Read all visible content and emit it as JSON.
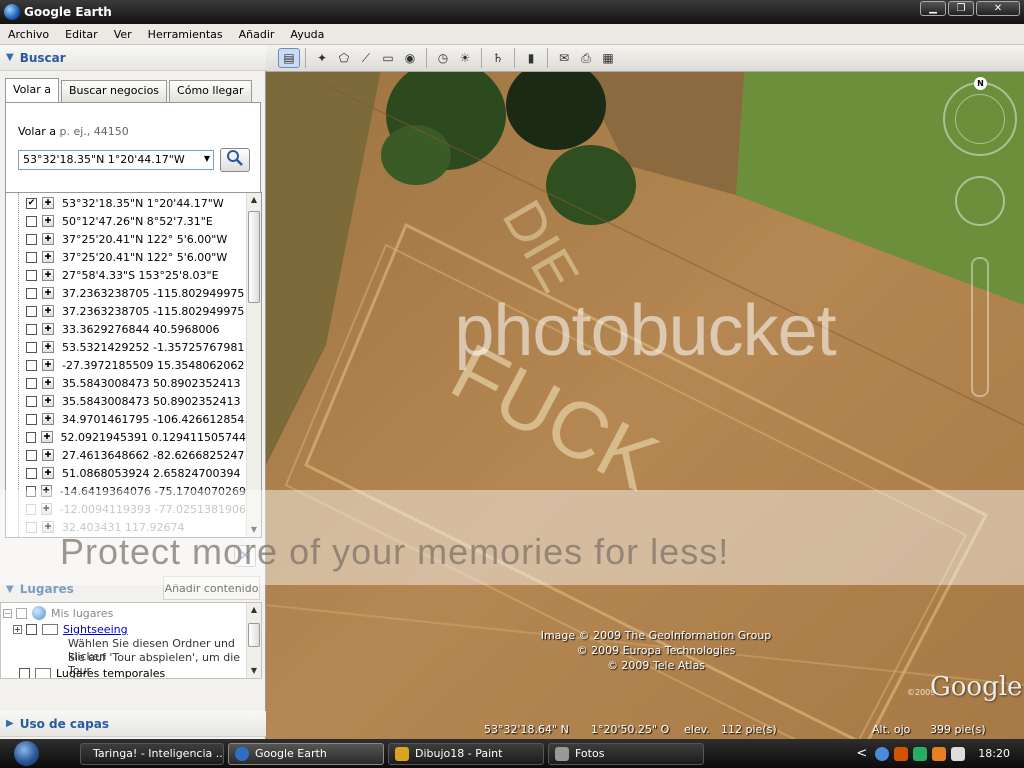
{
  "window": {
    "title": "Google Earth",
    "minimize": "▁",
    "restore": "❐",
    "close": "✕"
  },
  "menu": [
    "Archivo",
    "Editar",
    "Ver",
    "Herramientas",
    "Añadir",
    "Ayuda"
  ],
  "search": {
    "header": "Buscar",
    "tabs": [
      "Volar a",
      "Buscar negocios",
      "Cómo llegar"
    ],
    "hint_label": "Volar a",
    "hint_example": "p. ej., 44150",
    "query_value": "53°32'18.35\"N 1°20'44.17\"W",
    "results": [
      {
        "text": "53°32'18.35\"N 1°20'44.17\"W",
        "checked": true
      },
      {
        "text": "50°12'47.26\"N 8°52'7.31\"E",
        "checked": false
      },
      {
        "text": "37°25'20.41\"N 122° 5'6.00\"W",
        "checked": false
      },
      {
        "text": "37°25'20.41\"N 122° 5'6.00\"W",
        "checked": false
      },
      {
        "text": "27°58'4.33\"S 153°25'8.03\"E",
        "checked": false
      },
      {
        "text": "37.2363238705 -115.802949975",
        "checked": false
      },
      {
        "text": "37.2363238705 -115.802949975",
        "checked": false
      },
      {
        "text": "33.3629276844 40.5968006",
        "checked": false
      },
      {
        "text": "53.5321429252 -1.35725767981",
        "checked": false
      },
      {
        "text": "-27.3972185509 15.3548062062",
        "checked": false
      },
      {
        "text": "35.5843008473 50.8902352413",
        "checked": false
      },
      {
        "text": "35.5843008473 50.8902352413",
        "checked": false
      },
      {
        "text": "34.9701461795 -106.426612854",
        "checked": false
      },
      {
        "text": "52.0921945391 0.129411505744",
        "checked": false
      },
      {
        "text": "27.4613648662 -82.6266825247",
        "checked": false
      },
      {
        "text": "51.0868053924 2.65824700394",
        "checked": false
      },
      {
        "text": "-14.6419364076 -75.1704070269",
        "checked": false
      },
      {
        "text": "-12.0094119393 -77.0251381906",
        "checked": false
      },
      {
        "text": "32.403431 117.92674",
        "checked": false
      }
    ]
  },
  "places": {
    "header": "Lugares",
    "add_content": "Añadir contenido",
    "items": [
      {
        "label": "Mis lugares"
      },
      {
        "label": "Sightseeing",
        "desc1": "Wählen Sie diesen Ordner und klicken",
        "desc2": "Sie auf 'Tour abspielen', um die Tour"
      },
      {
        "label": "Lugares temporales"
      }
    ]
  },
  "layers": {
    "header": "Uso de capas"
  },
  "map": {
    "attribution": [
      "Image © 2009 The GeoInformation Group",
      "© 2009 Europa Technologies",
      "© 2009 Tele Atlas"
    ],
    "lat": "53°32'18.64\" N",
    "lon": "1°20'50.25\" O",
    "elev_label": "elev.",
    "elev_value": "112 pie(s)",
    "alt_label": "Alt. ojo",
    "alt_value": "399 pie(s)",
    "logo": "Google",
    "logo_year": "©2009",
    "north": "N",
    "crop_text_1": "DIE",
    "crop_text_2": "FUCK"
  },
  "watermark": {
    "brand": "photobucket",
    "promo": "Protect more of your memories for less!"
  },
  "taskbar": {
    "tasks": [
      {
        "label": "Taringa! - Inteligencia ...",
        "color": "#c0392b"
      },
      {
        "label": "Google Earth",
        "color": "#2f6fc0"
      },
      {
        "label": "Dibujo18 - Paint",
        "color": "#d9a520"
      },
      {
        "label": "Fotos",
        "color": "#999999"
      }
    ],
    "tray_chevron": "<",
    "clock": "18:20"
  },
  "colors": {
    "section_header": "#2a5a9e",
    "field": "#b58752",
    "grass": "#6b8f3a"
  }
}
